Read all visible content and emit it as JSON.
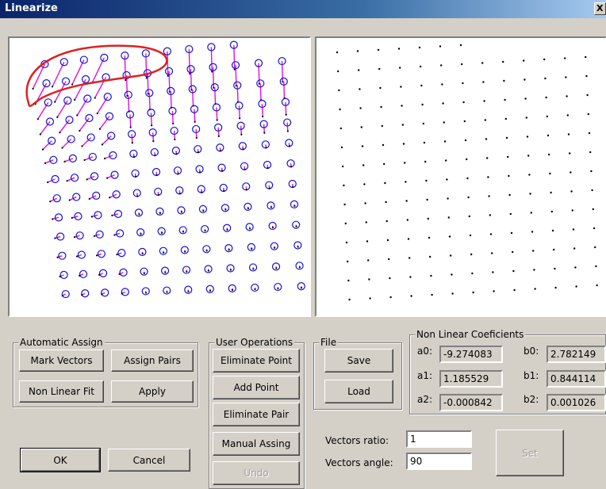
{
  "window": {
    "title": "Linearize",
    "close_glyph": "X"
  },
  "groups": {
    "automatic_assign": {
      "label": "Automatic Assign",
      "mark_vectors": "Mark Vectors",
      "assign_pairs": "Assign Pairs",
      "non_linear_fit": "Non Linear Fit",
      "apply": "Apply"
    },
    "user_operations": {
      "label": "User Operations",
      "eliminate_point": "Eliminate Point",
      "add_point": "Add Point",
      "eliminate_pair": "Eliminate Pair",
      "manual_assing": "Manual Assing",
      "undo": "Undo"
    },
    "file": {
      "label": "File",
      "save": "Save",
      "load": "Load"
    },
    "coefficients": {
      "label": "Non Linear Coeficients",
      "a0_label": "a0:",
      "a0": "-9.274083",
      "a1_label": "a1:",
      "a1": "1.185529",
      "a2_label": "a2:",
      "a2": "-0.000842",
      "b0_label": "b0:",
      "b0": "2.782149",
      "b1_label": "b1:",
      "b1": "0.844114",
      "b2_label": "b2:",
      "b2": "0.001026"
    }
  },
  "vectors": {
    "ratio_label": "Vectors ratio:",
    "ratio": "1",
    "angle_label": "Vectors angle:",
    "angle": "90",
    "set": "Set"
  },
  "dialog": {
    "ok": "OK",
    "cancel": "Cancel"
  },
  "colors": {
    "circle": "#1010e0",
    "vector": "#e010e0",
    "dot": "#000000",
    "annotation": "#e02020"
  }
}
